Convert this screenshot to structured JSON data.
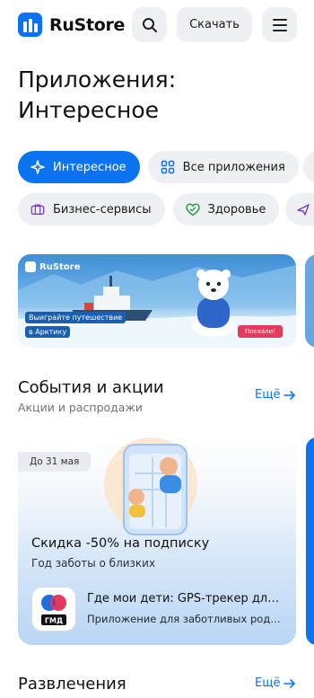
{
  "header": {
    "brand": "RuStore",
    "download_label": "Скачать",
    "icons": [
      "rustore-logo-icon",
      "search-icon",
      "menu-icon"
    ]
  },
  "page_title": "Приложения: Интересное",
  "chips_row1": [
    {
      "label": "Интересное",
      "icon": "sparkle-icon",
      "active": true
    },
    {
      "label": "Все приложения",
      "icon": "grid-icon",
      "active": false
    }
  ],
  "chips_row2": [
    {
      "label": "Бизнес-сервисы",
      "icon": "briefcase-icon",
      "active": false
    },
    {
      "label": "Здоровье",
      "icon": "heart-icon",
      "active": false
    }
  ],
  "banner": {
    "brand": "RuStore",
    "caption_line1": "Выиграйте путешествие",
    "caption_line2": "в Арктику",
    "cta": "Поехали!"
  },
  "events": {
    "title": "События и акции",
    "subtitle": "Акции и распродажи",
    "more": "Ещё"
  },
  "promo": {
    "date": "До 31 мая",
    "headline": "Скидка -50% на подписку",
    "sub": "Год заботы о близких",
    "app_icon_text": "ГМД",
    "app_name": "Где мои дети: GPS-трекер для детей",
    "app_desc": "Приложение для заботливых родителей"
  },
  "entertainment": {
    "title": "Развлечения",
    "more": "Ещё"
  },
  "colors": {
    "accent": "#0b73f0",
    "chip_bg": "#eef0f3",
    "cta": "#e43a5c"
  }
}
